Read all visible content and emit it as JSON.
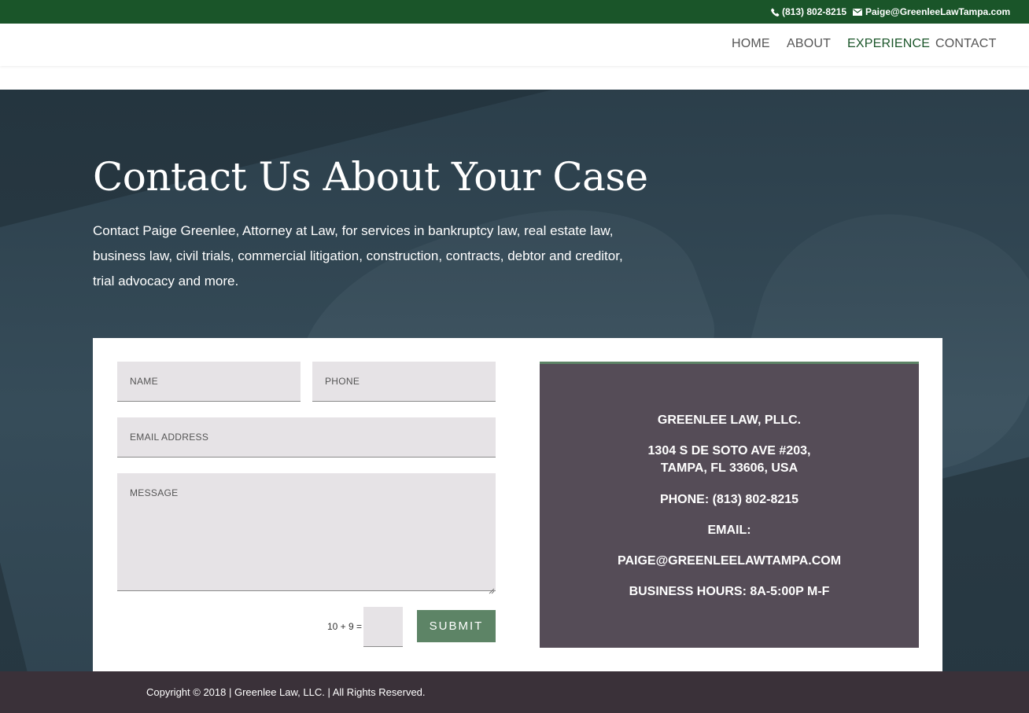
{
  "topbar": {
    "phone": "(813) 802-8215",
    "email": "Paige@GreenleeLawTampa.com"
  },
  "nav": {
    "items": [
      {
        "label": "HOME"
      },
      {
        "label": "ABOUT"
      },
      {
        "label": "EXPERIENCE",
        "active": true
      },
      {
        "label": "CONTACT"
      }
    ]
  },
  "hero": {
    "title": "Contact Us About Your Case",
    "intro": "Contact Paige Greenlee, Attorney at Law, for services in bankruptcy law, real estate law, business law, civil trials, commercial litigation, construction, contracts, debtor and creditor, trial advocacy and more."
  },
  "form": {
    "name_placeholder": "NAME",
    "phone_placeholder": "PHONE",
    "email_placeholder": "EMAIL ADDRESS",
    "message_placeholder": "MESSAGE",
    "captcha_label": "10 + 9 =",
    "captcha_value": "",
    "submit_label": "SUBMIT"
  },
  "info": {
    "firm": "GREENLEE LAW, PLLC.",
    "address_line1": "1304 S DE SOTO AVE #203,",
    "address_line2": "TAMPA, FL 33606, USA",
    "phone": "PHONE: (813) 802-8215",
    "email_label": "EMAIL:",
    "email": "PAIGE@GREENLEELAWTAMPA.COM",
    "hours": "BUSINESS HOURS: 8A-5:00P M-F"
  },
  "footer": {
    "copyright": "Copyright © 2018 | Greenlee Law, LLC. | All Rights Reserved."
  },
  "colors": {
    "brand_green": "#1a5529",
    "button_green": "#5d8466",
    "info_panel": "#554c57",
    "footer_bg": "#3a3139",
    "field_bg": "#e6e3e6"
  },
  "icons": {
    "phone": "phone-icon",
    "email": "envelope-icon"
  }
}
